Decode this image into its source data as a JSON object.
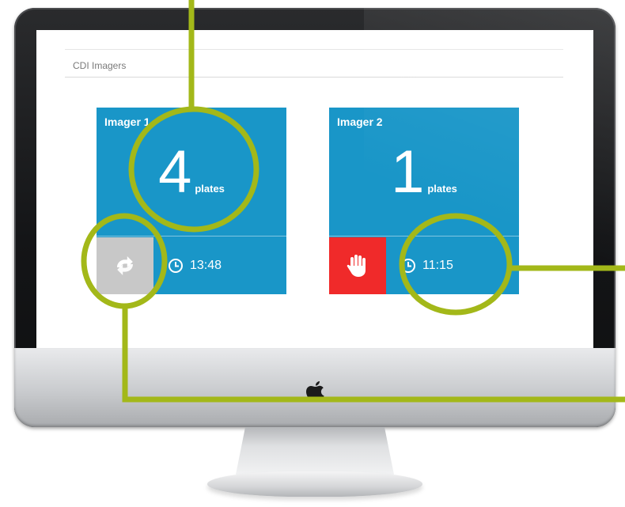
{
  "panel": {
    "title": "CDI Imagers"
  },
  "imagers": [
    {
      "name": "Imager 1",
      "count": "4",
      "unit": "plates",
      "time": "13:48",
      "action_icon": "refresh-icon",
      "action_color": "#c8c8c8"
    },
    {
      "name": "Imager 2",
      "count": "1",
      "unit": "plates",
      "time": "11:15",
      "action_icon": "stop-hand-icon",
      "action_color": "#f02a2a"
    }
  ],
  "colors": {
    "tile": "#1996c8",
    "callout": "#a3b819",
    "stop": "#f02a2a",
    "idle": "#c8c8c8"
  }
}
